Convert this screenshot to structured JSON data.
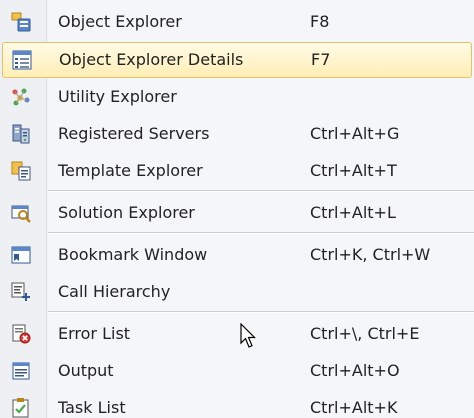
{
  "menu": {
    "items": [
      {
        "label": "Object Explorer",
        "shortcut": "F8",
        "icon": "object-explorer-icon"
      },
      {
        "label": "Object Explorer Details",
        "shortcut": "F7",
        "icon": "object-explorer-details-icon",
        "selected": true
      },
      {
        "label": "Utility Explorer",
        "shortcut": "",
        "icon": "utility-explorer-icon"
      },
      {
        "label": "Registered Servers",
        "shortcut": "Ctrl+Alt+G",
        "icon": "registered-servers-icon"
      },
      {
        "label": "Template Explorer",
        "shortcut": "Ctrl+Alt+T",
        "icon": "template-explorer-icon"
      },
      {
        "label": "Solution Explorer",
        "shortcut": "Ctrl+Alt+L",
        "icon": "solution-explorer-icon"
      },
      {
        "label": "Bookmark Window",
        "shortcut": "Ctrl+K, Ctrl+W",
        "icon": "bookmark-window-icon"
      },
      {
        "label": "Call Hierarchy",
        "shortcut": "",
        "icon": "call-hierarchy-icon"
      },
      {
        "label": "Error List",
        "shortcut": "Ctrl+\\, Ctrl+E",
        "icon": "error-list-icon"
      },
      {
        "label": "Output",
        "shortcut": "Ctrl+Alt+O",
        "icon": "output-icon"
      },
      {
        "label": "Task List",
        "shortcut": "Ctrl+Alt+K",
        "icon": "task-list-icon"
      }
    ]
  },
  "colors": {
    "highlight_bg": "#ffeeb5",
    "highlight_border": "#e5c365",
    "menu_bg": "#f5f6f8"
  }
}
